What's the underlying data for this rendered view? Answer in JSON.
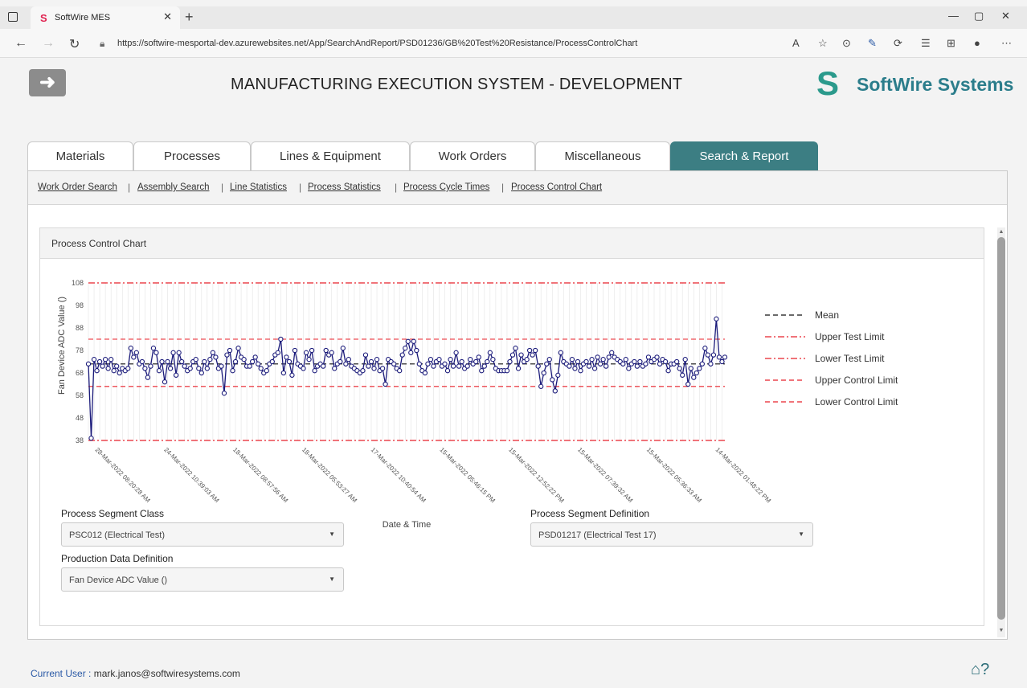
{
  "browser": {
    "tab_title": "SoftWire MES",
    "url": "https://softwire-mesportal-dev.azurewebsites.net/App/SearchAndReport/PSD01236/GB%20Test%20Resistance/ProcessControlChart"
  },
  "header": {
    "title": "MANUFACTURING EXECUTION SYSTEM - DEVELOPMENT",
    "logo_text": "SoftWire Systems",
    "brand_color": "#2b9a8c"
  },
  "nav": {
    "tabs": [
      "Materials",
      "Processes",
      "Lines & Equipment",
      "Work Orders",
      "Miscellaneous",
      "Search & Report"
    ],
    "active": "Search & Report"
  },
  "subnav": {
    "links": [
      "Work Order Search",
      "Assembly Search",
      "Line Statistics",
      "Process Statistics",
      "Process Cycle Times",
      "Process Control Chart"
    ]
  },
  "card": {
    "title": "Process Control Chart"
  },
  "chart_data": {
    "type": "line",
    "xlabel": "Date & Time",
    "ylabel": "Fan Device ADC Value ()",
    "ylim": [
      38,
      108
    ],
    "yticks": [
      38,
      48,
      58,
      68,
      78,
      88,
      98,
      108
    ],
    "xtick_labels": [
      "28-Mar-2022 08:20:28 AM",
      "24-Mar-2022 10:39:03 AM",
      "18-Mar-2022 08:57:56 AM",
      "18-Mar-2022 05:53:27 AM",
      "17-Mar-2022 10:40:54 AM",
      "15-Mar-2022 05:46:15 PM",
      "15-Mar-2022 12:52:22 PM",
      "15-Mar-2022 07:39:32 AM",
      "15-Mar-2022 05:36:33 AM",
      "14-Mar-2022 01:48:22 PM"
    ],
    "mean": 72,
    "upper_test_limit": 108,
    "lower_test_limit": 38,
    "upper_control_limit": 83,
    "lower_control_limit": 62,
    "legend": [
      "Mean",
      "Upper Test Limit",
      "Lower Test Limit",
      "Upper Control Limit",
      "Lower Control Limit"
    ],
    "legend_position": "right",
    "grid": true,
    "series": [
      {
        "color": "#1a1a7a",
        "values": [
          72,
          39,
          74,
          69,
          73,
          71,
          74,
          70,
          74,
          69,
          71,
          68,
          70,
          69,
          70,
          79,
          75,
          77,
          72,
          73,
          70,
          66,
          71,
          79,
          77,
          69,
          73,
          64,
          73,
          70,
          77,
          67,
          77,
          73,
          71,
          69,
          70,
          73,
          74,
          70,
          68,
          73,
          70,
          74,
          77,
          75,
          70,
          71,
          59,
          76,
          78,
          69,
          73,
          79,
          75,
          74,
          71,
          71,
          73,
          75,
          72,
          70,
          68,
          69,
          72,
          73,
          76,
          77,
          83,
          68,
          75,
          73,
          67,
          78,
          72,
          71,
          70,
          77,
          74,
          78,
          69,
          71,
          72,
          71,
          78,
          76,
          77,
          70,
          72,
          73,
          79,
          72,
          74,
          71,
          70,
          69,
          68,
          69,
          76,
          71,
          73,
          70,
          74,
          69,
          70,
          63,
          74,
          73,
          72,
          70,
          69,
          76,
          79,
          82,
          77,
          82,
          78,
          72,
          69,
          68,
          72,
          74,
          71,
          73,
          74,
          71,
          72,
          69,
          74,
          71,
          77,
          71,
          73,
          70,
          71,
          74,
          72,
          73,
          75,
          69,
          71,
          73,
          77,
          74,
          70,
          69,
          69,
          69,
          69,
          73,
          76,
          79,
          70,
          76,
          73,
          74,
          78,
          76,
          78,
          71,
          62,
          68,
          72,
          74,
          65,
          60,
          67,
          77,
          73,
          72,
          71,
          74,
          70,
          73,
          69,
          72,
          73,
          71,
          74,
          70,
          75,
          72,
          74,
          71,
          75,
          77,
          75,
          74,
          73,
          72,
          74,
          70,
          72,
          73,
          71,
          73,
          71,
          72,
          75,
          73,
          74,
          75,
          72,
          74,
          73,
          69,
          72,
          72,
          73,
          70,
          67,
          74,
          63,
          70,
          66,
          68,
          70,
          72,
          79,
          76,
          72,
          76,
          92,
          75,
          73,
          75
        ]
      }
    ]
  },
  "form": {
    "segment_class_label": "Process Segment Class",
    "segment_class_value": "PSC012 (Electrical Test)",
    "segment_def_label": "Process Segment Definition",
    "segment_def_value": "PSD01217 (Electrical Test 17)",
    "prod_data_label": "Production Data Definition",
    "prod_data_value": "Fan Device ADC Value ()"
  },
  "footer": {
    "user_label": "Current User :",
    "user_email": "mark.janos@softwiresystems.com"
  }
}
